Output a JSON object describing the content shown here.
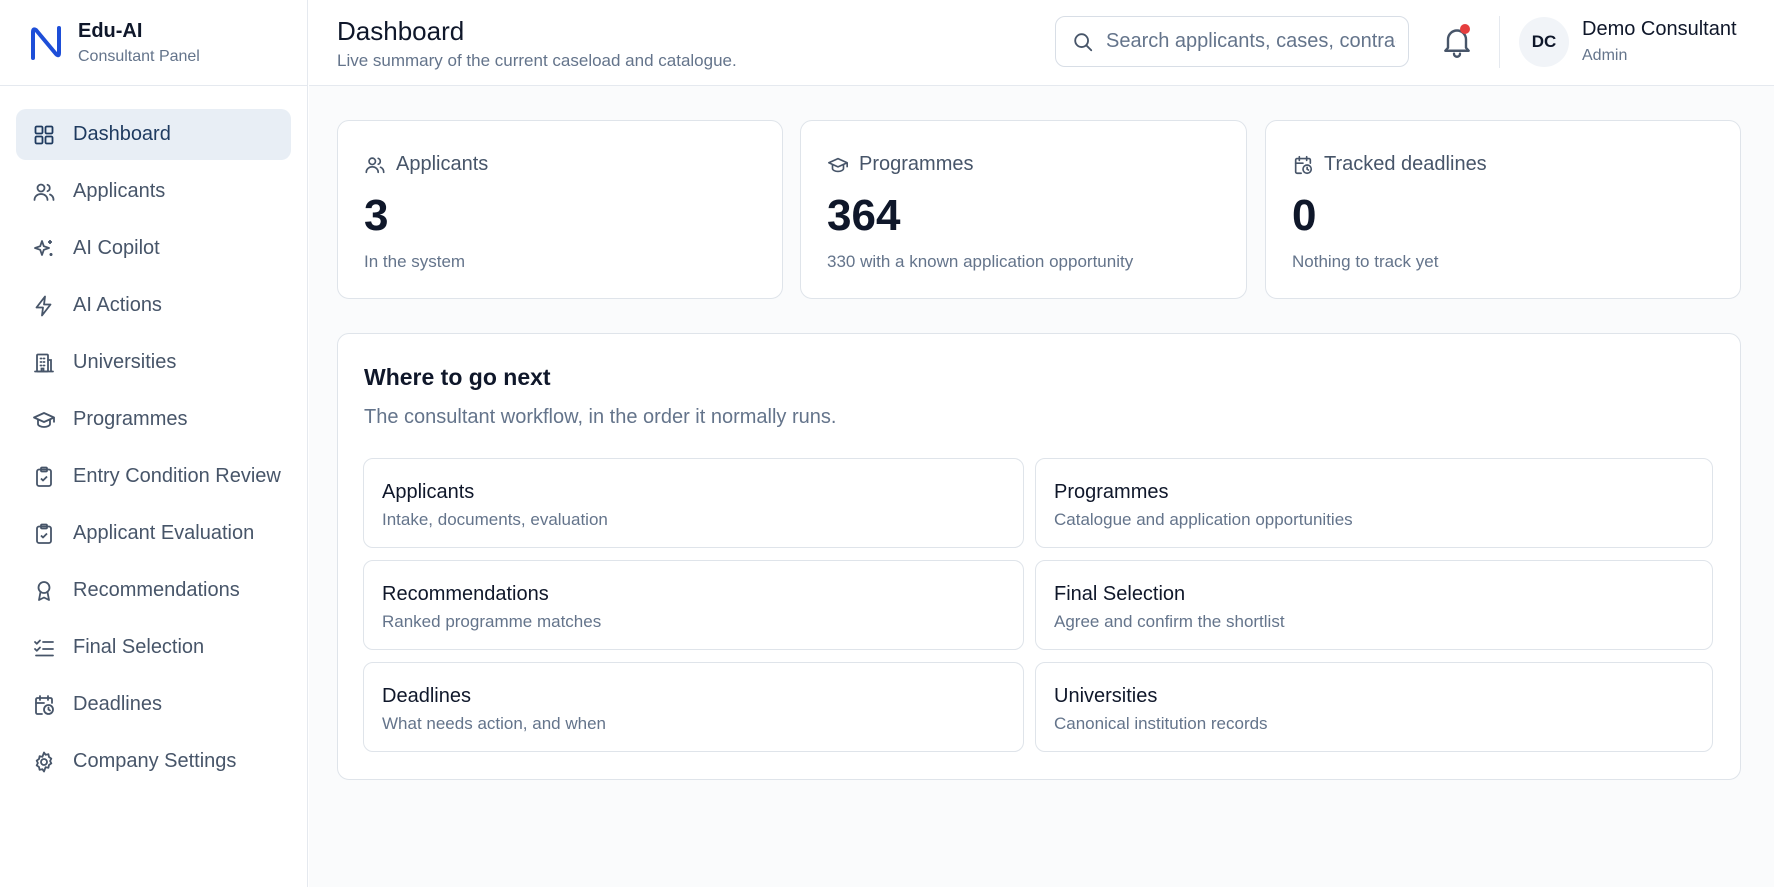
{
  "brand": {
    "title": "Edu-AI",
    "subtitle": "Consultant Panel",
    "icon": "brand-n-logo",
    "accent": "#1d4ed8"
  },
  "sidebar": {
    "items": [
      {
        "label": "Dashboard",
        "icon": "grid-icon",
        "active": true
      },
      {
        "label": "Applicants",
        "icon": "users-icon"
      },
      {
        "label": "AI Copilot",
        "icon": "sparkles-icon"
      },
      {
        "label": "AI Actions",
        "icon": "lightning-icon"
      },
      {
        "label": "Universities",
        "icon": "building-icon"
      },
      {
        "label": "Programmes",
        "icon": "graduation-cap-icon"
      },
      {
        "label": "Entry Condition Review",
        "icon": "clipboard-check-icon"
      },
      {
        "label": "Applicant Evaluation",
        "icon": "clipboard-check-icon"
      },
      {
        "label": "Recommendations",
        "icon": "award-icon"
      },
      {
        "label": "Final Selection",
        "icon": "list-checks-icon"
      },
      {
        "label": "Deadlines",
        "icon": "calendar-clock-icon"
      },
      {
        "label": "Company Settings",
        "icon": "gear-icon"
      }
    ]
  },
  "header": {
    "title": "Dashboard",
    "subtitle": "Live summary of the current caseload and catalogue.",
    "search": {
      "placeholder": "Search applicants, cases, contracts",
      "value": ""
    },
    "notifications": {
      "icon": "bell-icon",
      "has_unread": true,
      "dot_color": "#e53e3e"
    },
    "user": {
      "initials": "DC",
      "name": "Demo Consultant",
      "role": "Admin"
    }
  },
  "stats": [
    {
      "label": "Applicants",
      "icon": "users-icon",
      "value": "3",
      "note": "In the system"
    },
    {
      "label": "Programmes",
      "icon": "graduation-cap-icon",
      "value": "364",
      "note": "330 with a known application opportunity"
    },
    {
      "label": "Tracked deadlines",
      "icon": "calendar-clock-icon",
      "value": "0",
      "note": "Nothing to track yet"
    }
  ],
  "next": {
    "title": "Where to go next",
    "subtitle": "The consultant workflow, in the order it normally runs.",
    "tiles": [
      {
        "title": "Applicants",
        "desc": "Intake, documents, evaluation"
      },
      {
        "title": "Programmes",
        "desc": "Catalogue and application opportunities"
      },
      {
        "title": "Recommendations",
        "desc": "Ranked programme matches"
      },
      {
        "title": "Final Selection",
        "desc": "Agree and confirm the shortlist"
      },
      {
        "title": "Deadlines",
        "desc": "What needs action, and when"
      },
      {
        "title": "Universities",
        "desc": "Canonical institution records"
      }
    ]
  }
}
